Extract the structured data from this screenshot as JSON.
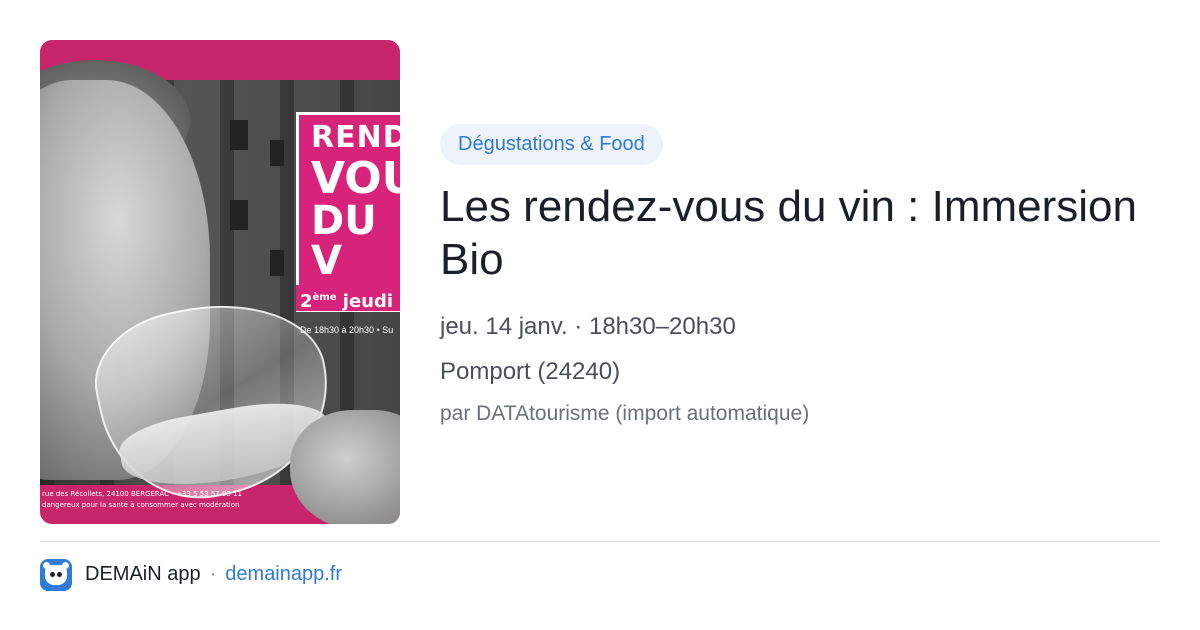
{
  "poster": {
    "sign_line1": "REND",
    "sign_line2": "VOU",
    "sign_line3": "DU V",
    "sign_band_num": "2",
    "sign_band_sup": "ème",
    "sign_band_text": " jeudi d",
    "sign_hours": "De 18h30 à 20h30 • Su",
    "footer_address": "rue des Récollets, 24100 BERGERAC - +33 5 53 57 03 11",
    "footer_warning": "dangereux pour la santé à consommer avec modération"
  },
  "event": {
    "category": "Dégustations & Food",
    "title": "Les rendez-vous du vin : Immersion Bio",
    "date": "jeu. 14 janv. · 18h30–20h30",
    "place": "Pomport (24240)",
    "author": "par DATAtourisme (import automatique)"
  },
  "footer": {
    "app_name": "DEMAiN app",
    "separator": "·",
    "domain": "demainapp.fr"
  },
  "colors": {
    "accent": "#2f7bd6",
    "poster_pink": "#c8266a",
    "pill_bg": "#eef3fa",
    "title": "#1b1f27"
  },
  "icons": {
    "app_icon": "demain-app-icon"
  }
}
